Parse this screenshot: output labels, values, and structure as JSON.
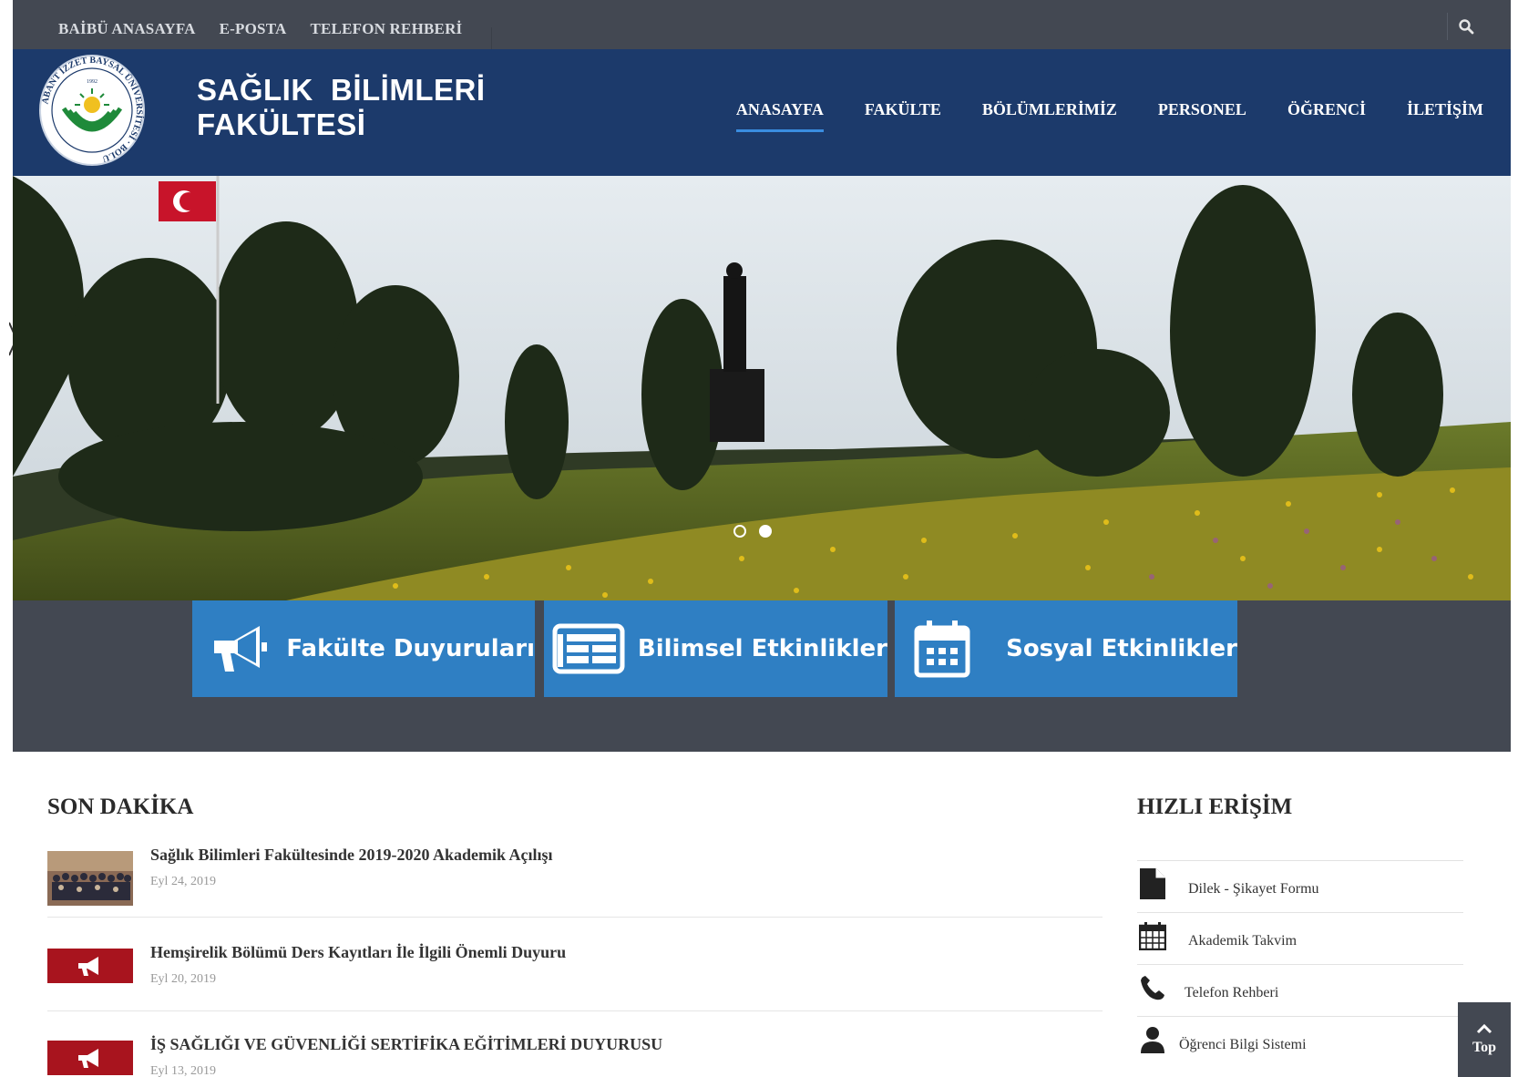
{
  "topbar": {
    "links": [
      "BAİBÜ ANASAYFA",
      "E-POSTA",
      "TELEFON REHBERİ"
    ]
  },
  "header": {
    "brand_line1": "SAĞLIK  BİLİMLERİ",
    "brand_line2": "FAKÜLTESİ",
    "logo_text_ring": "ABANT İZZET BAYSAL ÜNİVERSİTESİ · BOLU",
    "logo_year": "1992",
    "nav": [
      "ANASAYFA",
      "FAKÜLTE",
      "BÖLÜMLERİMİZ",
      "PERSONEL",
      "ÖĞRENCİ",
      "İLETİŞİM"
    ],
    "active_nav": "ANASAYFA"
  },
  "hero": {
    "slide_count": 2,
    "active_slide": 2
  },
  "features": [
    {
      "label": "Fakülte Duyuruları",
      "icon": "megaphone-icon"
    },
    {
      "label": "Bilimsel Etkinlikler",
      "icon": "newspaper-icon"
    },
    {
      "label": "Sosyal Etkinlikler",
      "icon": "calendar-icon"
    }
  ],
  "news": {
    "heading": "SON DAKİKA",
    "items": [
      {
        "title": "Sağlık Bilimleri Fakültesinde 2019-2020 Akademik Açılışı",
        "date": "Eyl 24, 2019",
        "thumb": "group-photo"
      },
      {
        "title": "Hemşirelik Bölümü Ders Kayıtları İle İlgili Önemli Duyuru",
        "date": "Eyl 20, 2019",
        "thumb": "megaphone-icon"
      },
      {
        "title": "İŞ SAĞLIĞI VE GÜVENLİĞİ SERTİFİKA EĞİTİMLERİ DUYURUSU",
        "date": "Eyl 13, 2019",
        "thumb": "megaphone-icon"
      }
    ]
  },
  "quick_access": {
    "heading": "HIZLI ERİŞİM",
    "items": [
      {
        "label": "Dilek - Şikayet Formu",
        "icon": "document-icon"
      },
      {
        "label": "Akademik Takvim",
        "icon": "calendar-icon"
      },
      {
        "label": "Telefon Rehberi",
        "icon": "phone-icon"
      },
      {
        "label": "Öğrenci Bilgi Sistemi",
        "icon": "user-icon"
      }
    ]
  },
  "top_button": {
    "label": "Top"
  },
  "colors": {
    "topbar": "#434852",
    "header": "#1c3a6b",
    "accent": "#2f7fc3",
    "announcement_red": "#a8141e"
  }
}
